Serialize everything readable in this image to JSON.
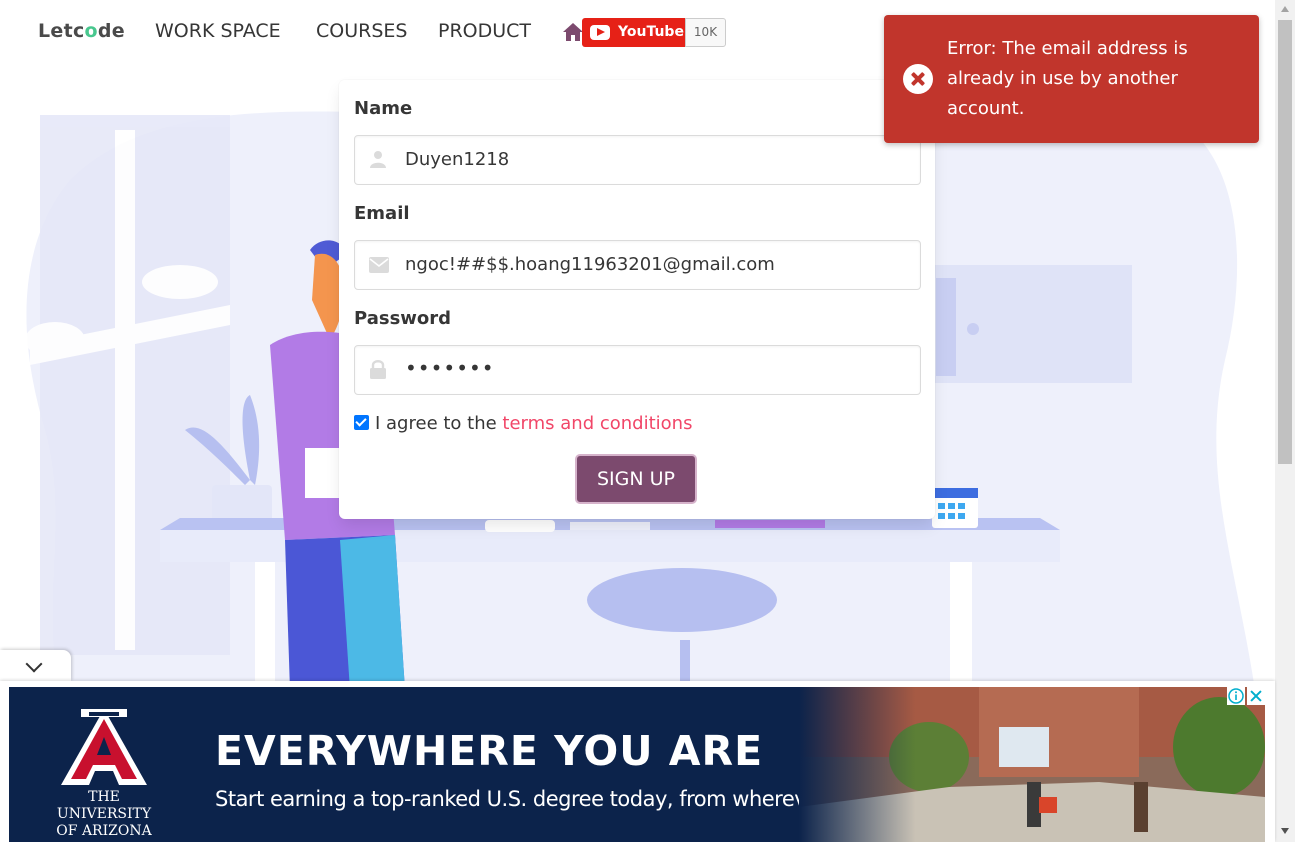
{
  "navbar": {
    "logo_prefix": "Letc",
    "logo_o": "o",
    "logo_suffix": "de",
    "items": [
      "WORK SPACE",
      "COURSES",
      "PRODUCT"
    ],
    "youtube_label": "YouTube",
    "youtube_count": "10K"
  },
  "form": {
    "name_label": "Name",
    "name_value": "Duyen1218",
    "email_label": "Email",
    "email_value": "ngoc!##$$.hoang11963201@gmail.com",
    "password_label": "Password",
    "password_mask": "•••••••",
    "agree_checked": true,
    "agree_text": "I agree to the ",
    "terms_link": "terms and conditions",
    "signup_label": "SIGN UP"
  },
  "toast": {
    "type": "error",
    "message": "Error: The email address is already in use by another account."
  },
  "ad": {
    "university_line1": "THE UNIVERSITY",
    "university_line2": "OF ARIZONA",
    "headline": "EVERYWHERE YOU ARE",
    "subline": "Start earning a top-ranked U.S. degree today, from wherever you are!"
  },
  "colors": {
    "toast_bg": "#c1352c",
    "signup_bg": "#7c4a6e",
    "terms_link": "#f14668",
    "ad_bg": "#0c234b",
    "youtube_red": "#e62117"
  }
}
